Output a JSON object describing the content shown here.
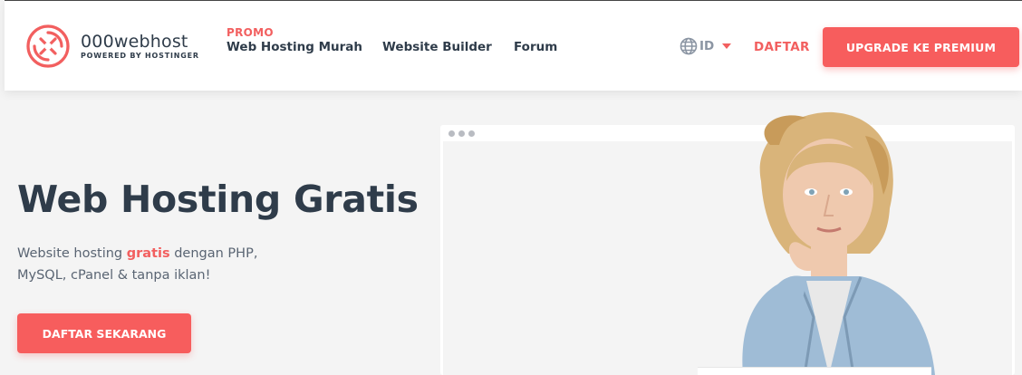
{
  "logo": {
    "name": "000webhost",
    "tagline": "POWERED BY HOSTINGER"
  },
  "nav": {
    "promo_tag": "PROMO",
    "items": [
      {
        "label": "Web Hosting Murah"
      },
      {
        "label": "Website Builder"
      },
      {
        "label": "Forum"
      }
    ]
  },
  "language": {
    "code": "ID"
  },
  "header_actions": {
    "signup_label": "DAFTAR",
    "upgrade_label": "UPGRADE KE PREMIUM"
  },
  "hero": {
    "title": "Web Hosting Gratis",
    "desc_before": "Website hosting ",
    "desc_highlight": "gratis",
    "desc_after": " dengan PHP, MySQL, cPanel & tanpa iklan!",
    "cta_label": "DAFTAR SEKARANG"
  },
  "colors": {
    "accent": "#f75d5d",
    "text_dark": "#2f3c4a",
    "background": "#f4f4f4"
  }
}
